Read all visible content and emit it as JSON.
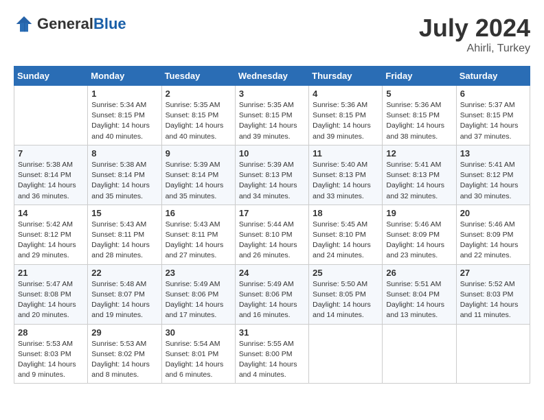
{
  "header": {
    "logo_general": "General",
    "logo_blue": "Blue",
    "month_year": "July 2024",
    "location": "Ahirli, Turkey"
  },
  "columns": [
    "Sunday",
    "Monday",
    "Tuesday",
    "Wednesday",
    "Thursday",
    "Friday",
    "Saturday"
  ],
  "weeks": [
    [
      {
        "day": "",
        "sunrise": "",
        "sunset": "",
        "daylight": ""
      },
      {
        "day": "1",
        "sunrise": "Sunrise: 5:34 AM",
        "sunset": "Sunset: 8:15 PM",
        "daylight": "Daylight: 14 hours and 40 minutes."
      },
      {
        "day": "2",
        "sunrise": "Sunrise: 5:35 AM",
        "sunset": "Sunset: 8:15 PM",
        "daylight": "Daylight: 14 hours and 40 minutes."
      },
      {
        "day": "3",
        "sunrise": "Sunrise: 5:35 AM",
        "sunset": "Sunset: 8:15 PM",
        "daylight": "Daylight: 14 hours and 39 minutes."
      },
      {
        "day": "4",
        "sunrise": "Sunrise: 5:36 AM",
        "sunset": "Sunset: 8:15 PM",
        "daylight": "Daylight: 14 hours and 39 minutes."
      },
      {
        "day": "5",
        "sunrise": "Sunrise: 5:36 AM",
        "sunset": "Sunset: 8:15 PM",
        "daylight": "Daylight: 14 hours and 38 minutes."
      },
      {
        "day": "6",
        "sunrise": "Sunrise: 5:37 AM",
        "sunset": "Sunset: 8:15 PM",
        "daylight": "Daylight: 14 hours and 37 minutes."
      }
    ],
    [
      {
        "day": "7",
        "sunrise": "Sunrise: 5:38 AM",
        "sunset": "Sunset: 8:14 PM",
        "daylight": "Daylight: 14 hours and 36 minutes."
      },
      {
        "day": "8",
        "sunrise": "Sunrise: 5:38 AM",
        "sunset": "Sunset: 8:14 PM",
        "daylight": "Daylight: 14 hours and 35 minutes."
      },
      {
        "day": "9",
        "sunrise": "Sunrise: 5:39 AM",
        "sunset": "Sunset: 8:14 PM",
        "daylight": "Daylight: 14 hours and 35 minutes."
      },
      {
        "day": "10",
        "sunrise": "Sunrise: 5:39 AM",
        "sunset": "Sunset: 8:13 PM",
        "daylight": "Daylight: 14 hours and 34 minutes."
      },
      {
        "day": "11",
        "sunrise": "Sunrise: 5:40 AM",
        "sunset": "Sunset: 8:13 PM",
        "daylight": "Daylight: 14 hours and 33 minutes."
      },
      {
        "day": "12",
        "sunrise": "Sunrise: 5:41 AM",
        "sunset": "Sunset: 8:13 PM",
        "daylight": "Daylight: 14 hours and 32 minutes."
      },
      {
        "day": "13",
        "sunrise": "Sunrise: 5:41 AM",
        "sunset": "Sunset: 8:12 PM",
        "daylight": "Daylight: 14 hours and 30 minutes."
      }
    ],
    [
      {
        "day": "14",
        "sunrise": "Sunrise: 5:42 AM",
        "sunset": "Sunset: 8:12 PM",
        "daylight": "Daylight: 14 hours and 29 minutes."
      },
      {
        "day": "15",
        "sunrise": "Sunrise: 5:43 AM",
        "sunset": "Sunset: 8:11 PM",
        "daylight": "Daylight: 14 hours and 28 minutes."
      },
      {
        "day": "16",
        "sunrise": "Sunrise: 5:43 AM",
        "sunset": "Sunset: 8:11 PM",
        "daylight": "Daylight: 14 hours and 27 minutes."
      },
      {
        "day": "17",
        "sunrise": "Sunrise: 5:44 AM",
        "sunset": "Sunset: 8:10 PM",
        "daylight": "Daylight: 14 hours and 26 minutes."
      },
      {
        "day": "18",
        "sunrise": "Sunrise: 5:45 AM",
        "sunset": "Sunset: 8:10 PM",
        "daylight": "Daylight: 14 hours and 24 minutes."
      },
      {
        "day": "19",
        "sunrise": "Sunrise: 5:46 AM",
        "sunset": "Sunset: 8:09 PM",
        "daylight": "Daylight: 14 hours and 23 minutes."
      },
      {
        "day": "20",
        "sunrise": "Sunrise: 5:46 AM",
        "sunset": "Sunset: 8:09 PM",
        "daylight": "Daylight: 14 hours and 22 minutes."
      }
    ],
    [
      {
        "day": "21",
        "sunrise": "Sunrise: 5:47 AM",
        "sunset": "Sunset: 8:08 PM",
        "daylight": "Daylight: 14 hours and 20 minutes."
      },
      {
        "day": "22",
        "sunrise": "Sunrise: 5:48 AM",
        "sunset": "Sunset: 8:07 PM",
        "daylight": "Daylight: 14 hours and 19 minutes."
      },
      {
        "day": "23",
        "sunrise": "Sunrise: 5:49 AM",
        "sunset": "Sunset: 8:06 PM",
        "daylight": "Daylight: 14 hours and 17 minutes."
      },
      {
        "day": "24",
        "sunrise": "Sunrise: 5:49 AM",
        "sunset": "Sunset: 8:06 PM",
        "daylight": "Daylight: 14 hours and 16 minutes."
      },
      {
        "day": "25",
        "sunrise": "Sunrise: 5:50 AM",
        "sunset": "Sunset: 8:05 PM",
        "daylight": "Daylight: 14 hours and 14 minutes."
      },
      {
        "day": "26",
        "sunrise": "Sunrise: 5:51 AM",
        "sunset": "Sunset: 8:04 PM",
        "daylight": "Daylight: 14 hours and 13 minutes."
      },
      {
        "day": "27",
        "sunrise": "Sunrise: 5:52 AM",
        "sunset": "Sunset: 8:03 PM",
        "daylight": "Daylight: 14 hours and 11 minutes."
      }
    ],
    [
      {
        "day": "28",
        "sunrise": "Sunrise: 5:53 AM",
        "sunset": "Sunset: 8:03 PM",
        "daylight": "Daylight: 14 hours and 9 minutes."
      },
      {
        "day": "29",
        "sunrise": "Sunrise: 5:53 AM",
        "sunset": "Sunset: 8:02 PM",
        "daylight": "Daylight: 14 hours and 8 minutes."
      },
      {
        "day": "30",
        "sunrise": "Sunrise: 5:54 AM",
        "sunset": "Sunset: 8:01 PM",
        "daylight": "Daylight: 14 hours and 6 minutes."
      },
      {
        "day": "31",
        "sunrise": "Sunrise: 5:55 AM",
        "sunset": "Sunset: 8:00 PM",
        "daylight": "Daylight: 14 hours and 4 minutes."
      },
      {
        "day": "",
        "sunrise": "",
        "sunset": "",
        "daylight": ""
      },
      {
        "day": "",
        "sunrise": "",
        "sunset": "",
        "daylight": ""
      },
      {
        "day": "",
        "sunrise": "",
        "sunset": "",
        "daylight": ""
      }
    ]
  ]
}
